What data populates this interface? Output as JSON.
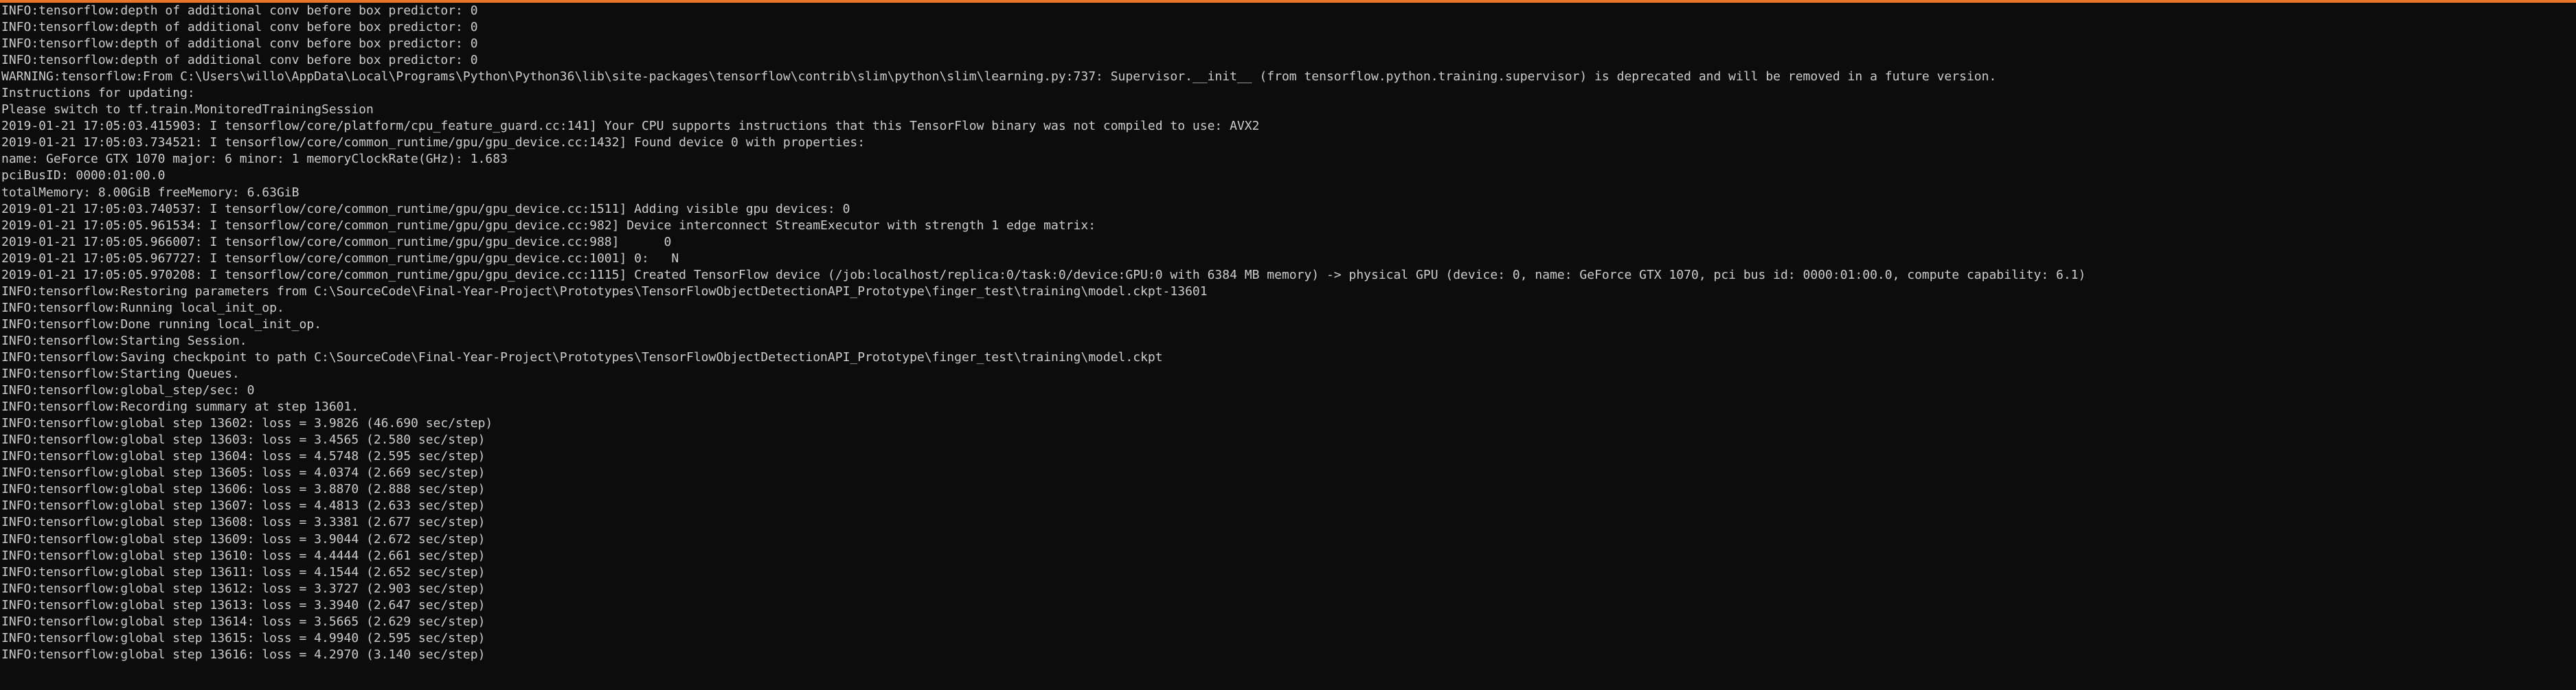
{
  "colors": {
    "background": "#0c0c0c",
    "text": "#cccccc",
    "window_border": "#e8742c"
  },
  "console": {
    "lines": [
      "INFO:tensorflow:depth of additional conv before box predictor: 0",
      "INFO:tensorflow:depth of additional conv before box predictor: 0",
      "INFO:tensorflow:depth of additional conv before box predictor: 0",
      "INFO:tensorflow:depth of additional conv before box predictor: 0",
      "WARNING:tensorflow:From C:\\Users\\willo\\AppData\\Local\\Programs\\Python\\Python36\\lib\\site-packages\\tensorflow\\contrib\\slim\\python\\slim\\learning.py:737: Supervisor.__init__ (from tensorflow.python.training.supervisor) is deprecated and will be removed in a future version.",
      "Instructions for updating:",
      "Please switch to tf.train.MonitoredTrainingSession",
      "2019-01-21 17:05:03.415903: I tensorflow/core/platform/cpu_feature_guard.cc:141] Your CPU supports instructions that this TensorFlow binary was not compiled to use: AVX2",
      "2019-01-21 17:05:03.734521: I tensorflow/core/common_runtime/gpu/gpu_device.cc:1432] Found device 0 with properties:",
      "name: GeForce GTX 1070 major: 6 minor: 1 memoryClockRate(GHz): 1.683",
      "pciBusID: 0000:01:00.0",
      "totalMemory: 8.00GiB freeMemory: 6.63GiB",
      "2019-01-21 17:05:03.740537: I tensorflow/core/common_runtime/gpu/gpu_device.cc:1511] Adding visible gpu devices: 0",
      "2019-01-21 17:05:05.961534: I tensorflow/core/common_runtime/gpu/gpu_device.cc:982] Device interconnect StreamExecutor with strength 1 edge matrix:",
      "2019-01-21 17:05:05.966007: I tensorflow/core/common_runtime/gpu/gpu_device.cc:988]      0",
      "2019-01-21 17:05:05.967727: I tensorflow/core/common_runtime/gpu/gpu_device.cc:1001] 0:   N",
      "2019-01-21 17:05:05.970208: I tensorflow/core/common_runtime/gpu/gpu_device.cc:1115] Created TensorFlow device (/job:localhost/replica:0/task:0/device:GPU:0 with 6384 MB memory) -> physical GPU (device: 0, name: GeForce GTX 1070, pci bus id: 0000:01:00.0, compute capability: 6.1)",
      "INFO:tensorflow:Restoring parameters from C:\\SourceCode\\Final-Year-Project\\Prototypes\\TensorFlowObjectDetectionAPI_Prototype\\finger_test\\training\\model.ckpt-13601",
      "INFO:tensorflow:Running local_init_op.",
      "INFO:tensorflow:Done running local_init_op.",
      "INFO:tensorflow:Starting Session.",
      "INFO:tensorflow:Saving checkpoint to path C:\\SourceCode\\Final-Year-Project\\Prototypes\\TensorFlowObjectDetectionAPI_Prototype\\finger_test\\training\\model.ckpt",
      "INFO:tensorflow:Starting Queues.",
      "INFO:tensorflow:global_step/sec: 0",
      "INFO:tensorflow:Recording summary at step 13601.",
      "INFO:tensorflow:global step 13602: loss = 3.9826 (46.690 sec/step)",
      "INFO:tensorflow:global step 13603: loss = 3.4565 (2.580 sec/step)",
      "INFO:tensorflow:global step 13604: loss = 4.5748 (2.595 sec/step)",
      "INFO:tensorflow:global step 13605: loss = 4.0374 (2.669 sec/step)",
      "INFO:tensorflow:global step 13606: loss = 3.8870 (2.888 sec/step)",
      "INFO:tensorflow:global step 13607: loss = 4.4813 (2.633 sec/step)",
      "INFO:tensorflow:global step 13608: loss = 3.3381 (2.677 sec/step)",
      "INFO:tensorflow:global step 13609: loss = 3.9044 (2.672 sec/step)",
      "INFO:tensorflow:global step 13610: loss = 4.4444 (2.661 sec/step)",
      "INFO:tensorflow:global step 13611: loss = 4.1544 (2.652 sec/step)",
      "INFO:tensorflow:global step 13612: loss = 3.3727 (2.903 sec/step)",
      "INFO:tensorflow:global step 13613: loss = 3.3940 (2.647 sec/step)",
      "INFO:tensorflow:global step 13614: loss = 3.5665 (2.629 sec/step)",
      "INFO:tensorflow:global step 13615: loss = 4.9940 (2.595 sec/step)",
      "INFO:tensorflow:global step 13616: loss = 4.2970 (3.140 sec/step)"
    ]
  }
}
